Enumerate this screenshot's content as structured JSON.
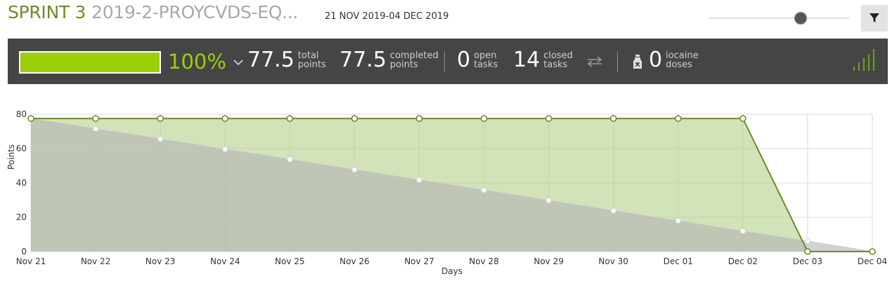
{
  "header": {
    "sprint_name": "SPRINT 3",
    "project_name": "2019-2-PROYCVDS-EQ...",
    "dates": "21 NOV 2019-04 DEC 2019"
  },
  "zoom": {
    "level": 0.62
  },
  "toolbar": {
    "filter_icon": "filter-icon"
  },
  "stats": {
    "progress_fraction": 1.0,
    "progress_pct": "100%",
    "total_points": {
      "value": "77.5",
      "label1": "total",
      "label2": "points"
    },
    "completed_points": {
      "value": "77.5",
      "label1": "completed",
      "label2": "points"
    },
    "open_tasks": {
      "value": "0",
      "label1": "open",
      "label2": "tasks"
    },
    "closed_tasks": {
      "value": "14",
      "label1": "closed",
      "label2": "tasks"
    },
    "iocaine": {
      "value": "0",
      "label1": "iocaine",
      "label2": "doses"
    }
  },
  "colors": {
    "accent": "#9dce0a",
    "real_line": "#6c8b2b",
    "real_fill": "#b7d08e",
    "ideal_fill": "#b4b4b4",
    "stats_bg": "#454545"
  },
  "chart_data": {
    "type": "area",
    "xlabel": "Days",
    "ylabel": "Points",
    "ylim": [
      0,
      80
    ],
    "yticks": [
      0,
      20,
      40,
      60,
      80
    ],
    "categories": [
      "Nov 21",
      "Nov 22",
      "Nov 23",
      "Nov 24",
      "Nov 25",
      "Nov 26",
      "Nov 27",
      "Nov 28",
      "Nov 29",
      "Nov 30",
      "Dec 01",
      "Dec 02",
      "Dec 03",
      "Dec 04"
    ],
    "grid": true,
    "series": [
      {
        "key": "real",
        "values": [
          77.5,
          77.5,
          77.5,
          77.5,
          77.5,
          77.5,
          77.5,
          77.5,
          77.5,
          77.5,
          77.5,
          77.5,
          0,
          0
        ]
      },
      {
        "key": "ideal",
        "values": [
          77.5,
          71.5,
          65.6,
          59.6,
          53.7,
          47.7,
          41.7,
          35.8,
          29.8,
          23.8,
          17.9,
          11.9,
          6.0,
          0
        ]
      }
    ]
  }
}
